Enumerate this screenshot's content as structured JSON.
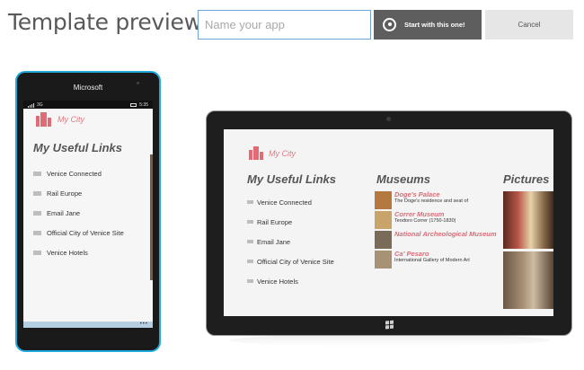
{
  "header": {
    "title": "Template preview",
    "app_name_placeholder": "Name your app",
    "start_button_label": "Start with this one!",
    "cancel_button_label": "Cancel"
  },
  "phone": {
    "brand": "Microsoft",
    "status": {
      "network": "3G",
      "time": "5:35"
    },
    "app_name": "My City",
    "links_heading": "My Useful Links",
    "links": [
      {
        "label": "Venice Connected",
        "icon": "cloud-icon"
      },
      {
        "label": "Rail Europe",
        "icon": "train-icon"
      },
      {
        "label": "Email Jane",
        "icon": "mail-icon"
      },
      {
        "label": "Official City of Venice Site",
        "icon": "document-icon"
      },
      {
        "label": "Venice Hotels",
        "icon": "hotel-icon"
      }
    ],
    "more_label": "•••"
  },
  "tablet": {
    "app_name": "My City",
    "links_heading": "My Useful Links",
    "links": [
      {
        "label": "Venice Connected",
        "icon": "cloud-icon"
      },
      {
        "label": "Rail Europe",
        "icon": "train-icon"
      },
      {
        "label": "Email Jane",
        "icon": "mail-icon"
      },
      {
        "label": "Official City of Venice Site",
        "icon": "document-icon"
      },
      {
        "label": "Venice Hotels",
        "icon": "hotel-icon"
      }
    ],
    "museums_heading": "Museums",
    "museums": [
      {
        "name": "Doge's Palace",
        "desc": "The Doge's residence and seat of",
        "thumb_color": "#b5783f"
      },
      {
        "name": "Correr Museum",
        "desc": "Teodoro Correr (1750-1830)",
        "thumb_color": "#c8a46a"
      },
      {
        "name": "National Archeological Museum",
        "desc": "",
        "thumb_color": "#7a6a58"
      },
      {
        "name": "Ca' Pesaro",
        "desc": "International Gallery of Modern Art",
        "thumb_color": "#a89276"
      }
    ],
    "pictures_heading": "Pictures"
  },
  "colors": {
    "accent": "#df7a82",
    "phone_frame": "#21a9dc",
    "start_button": "#5e5e5e"
  }
}
